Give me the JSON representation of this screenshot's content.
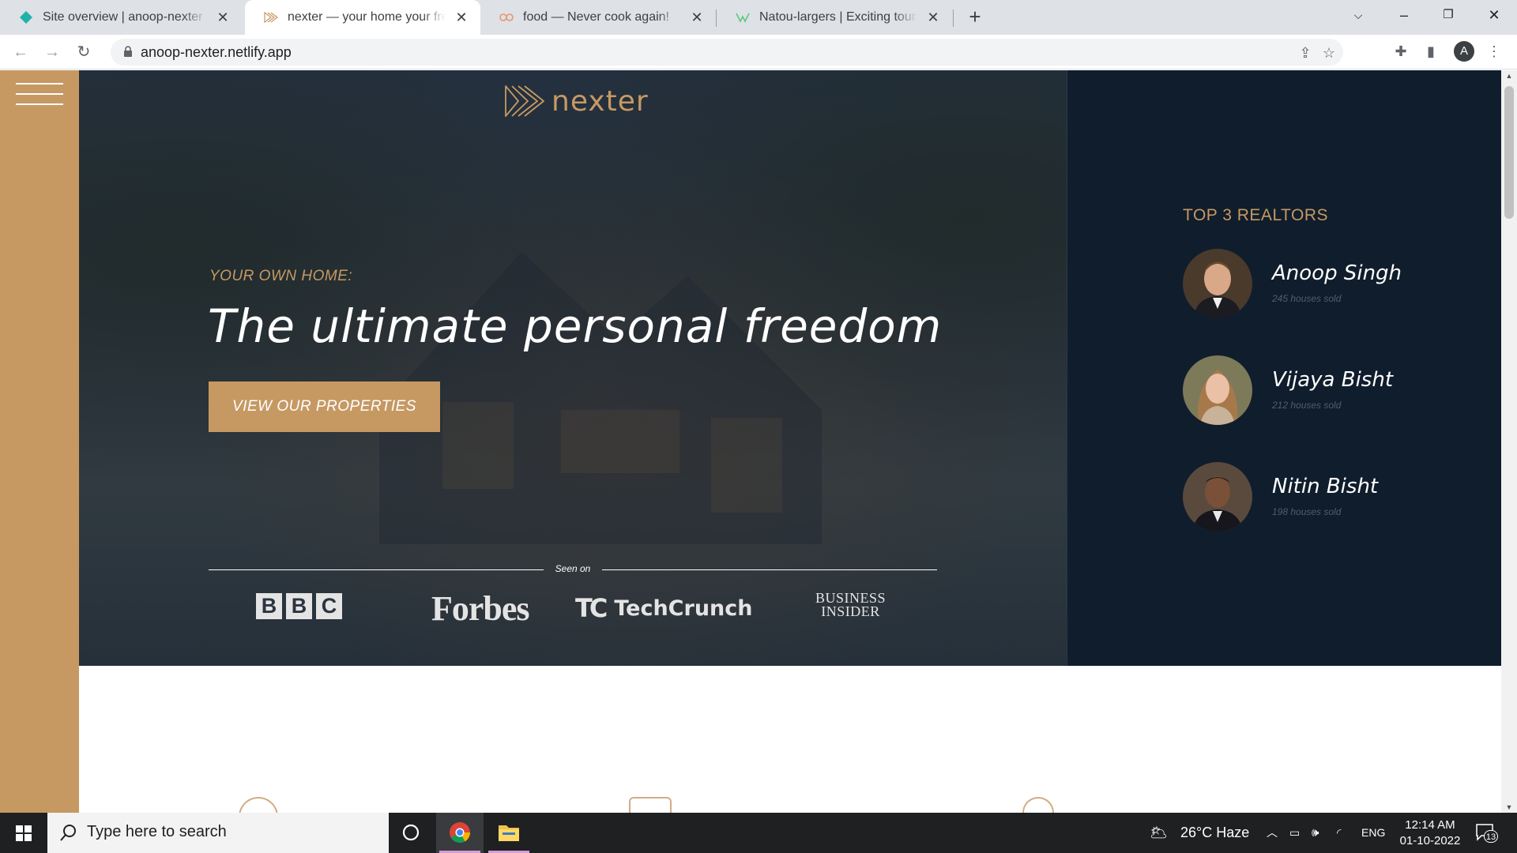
{
  "browser": {
    "tabs": [
      {
        "title": "Site overview | anoop-nexter",
        "active": false
      },
      {
        "title": "nexter — your home your freedom",
        "active": true
      },
      {
        "title": "food — Never cook again!",
        "active": false
      },
      {
        "title": "Natou-largers | Exciting tours for adventurous people",
        "active": false
      }
    ],
    "new_tab_icon": "plus-icon",
    "url": "anoop-nexter.netlify.app",
    "profile_initial": "A"
  },
  "page": {
    "brand_name": "nexter",
    "eyebrow": "YOUR OWN HOME:",
    "headline": "The ultimate personal freedom",
    "cta_label": "VIEW OUR PROPERTIES",
    "seen_on_label": "Seen on",
    "press_logos": {
      "bbc": [
        "B",
        "B",
        "C"
      ],
      "forbes": "Forbes",
      "techcrunch_mark": "TC",
      "techcrunch": "TechCrunch",
      "business_insider_1": "BUSINESS",
      "business_insider_2": "INSIDER"
    },
    "realtors_title": "TOP 3 REALTORS",
    "realtors": [
      {
        "name": "Anoop Singh",
        "sold": "245 houses sold"
      },
      {
        "name": "Vijaya Bisht",
        "sold": "212 houses sold"
      },
      {
        "name": "Nitin Bisht",
        "sold": "198 houses sold"
      }
    ],
    "accent_color": "#c69963",
    "dark_color": "#101d2c"
  },
  "taskbar": {
    "search_placeholder": "Type here to search",
    "weather": "26°C Haze",
    "language": "ENG",
    "time": "12:14 AM",
    "date": "01-10-2022",
    "notification_count": "13"
  }
}
